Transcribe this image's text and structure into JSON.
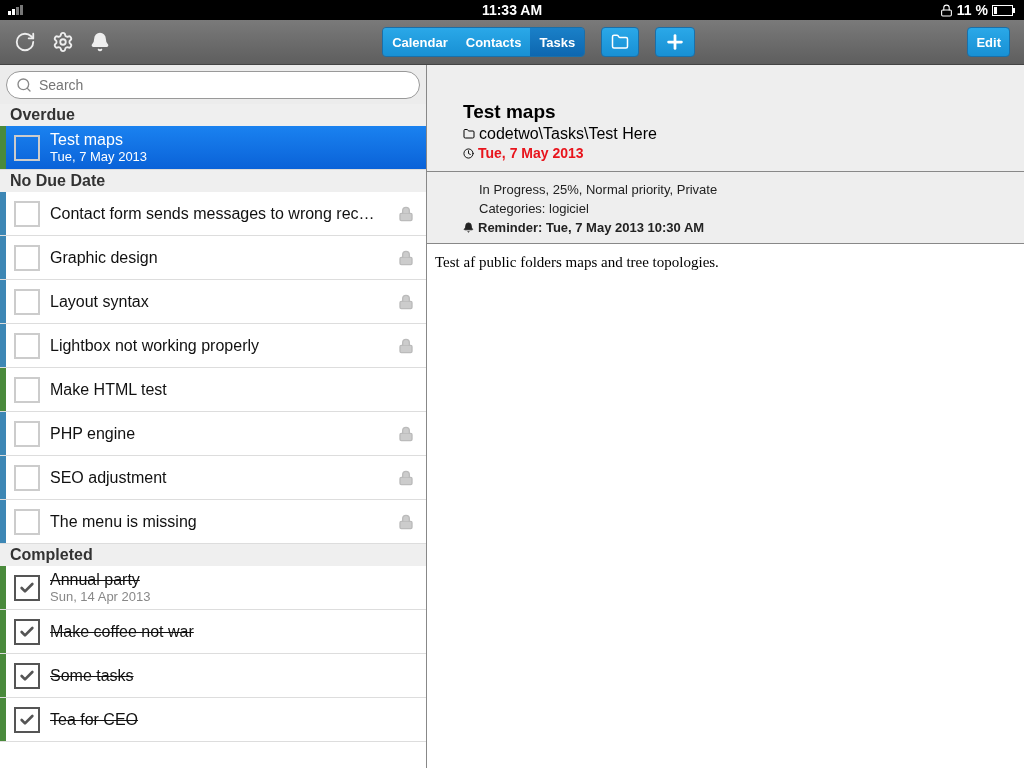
{
  "status_bar": {
    "time": "11:33 AM",
    "battery": "11 %"
  },
  "toolbar": {
    "segments": [
      {
        "label": "Calendar",
        "selected": false
      },
      {
        "label": "Contacts",
        "selected": false
      },
      {
        "label": "Tasks",
        "selected": true
      }
    ],
    "edit": "Edit"
  },
  "search": {
    "placeholder": "Search"
  },
  "sections": [
    {
      "title": "Overdue",
      "tasks": [
        {
          "title": "Test maps",
          "date": "Tue, 7 May 2013",
          "color": "#4a8a3c",
          "checked": false,
          "locked": false,
          "selected": true
        }
      ]
    },
    {
      "title": "No Due Date",
      "tasks": [
        {
          "title": "Contact form sends messages to wrong rec…",
          "color": "#3d87b5",
          "checked": false,
          "locked": true,
          "selected": false
        },
        {
          "title": "Graphic design",
          "color": "#3d87b5",
          "checked": false,
          "locked": true,
          "selected": false
        },
        {
          "title": "Layout syntax",
          "color": "#3d87b5",
          "checked": false,
          "locked": true,
          "selected": false
        },
        {
          "title": "Lightbox not working properly",
          "color": "#3d87b5",
          "checked": false,
          "locked": true,
          "selected": false
        },
        {
          "title": "Make HTML test",
          "color": "#4a8a3c",
          "checked": false,
          "locked": false,
          "selected": false
        },
        {
          "title": "PHP engine",
          "color": "#3d87b5",
          "checked": false,
          "locked": true,
          "selected": false
        },
        {
          "title": "SEO adjustment",
          "color": "#3d87b5",
          "checked": false,
          "locked": true,
          "selected": false
        },
        {
          "title": "The menu is missing",
          "color": "#3d87b5",
          "checked": false,
          "locked": true,
          "selected": false
        }
      ]
    },
    {
      "title": "Completed",
      "tasks": [
        {
          "title": "Annual party",
          "date": "Sun, 14 Apr 2013",
          "color": "#4a8a3c",
          "checked": true,
          "locked": false,
          "selected": false
        },
        {
          "title": "Make coffee not war",
          "color": "#4a8a3c",
          "checked": true,
          "locked": false,
          "selected": false
        },
        {
          "title": "Some tasks",
          "color": "#4a8a3c",
          "checked": true,
          "locked": false,
          "selected": false
        },
        {
          "title": "Tea for CEO",
          "color": "#4a8a3c",
          "checked": true,
          "locked": false,
          "selected": false
        }
      ]
    }
  ],
  "detail": {
    "title": "Test maps",
    "folder": "codetwo\\Tasks\\Test Here",
    "due": "Tue, 7 May 2013",
    "status": "In Progress, 25%, Normal priority, Private",
    "categories": "Categories: logiciel",
    "reminder": "Reminder: Tue, 7 May 2013 10:30 AM",
    "body": "Test af public folders maps and tree topologies."
  }
}
